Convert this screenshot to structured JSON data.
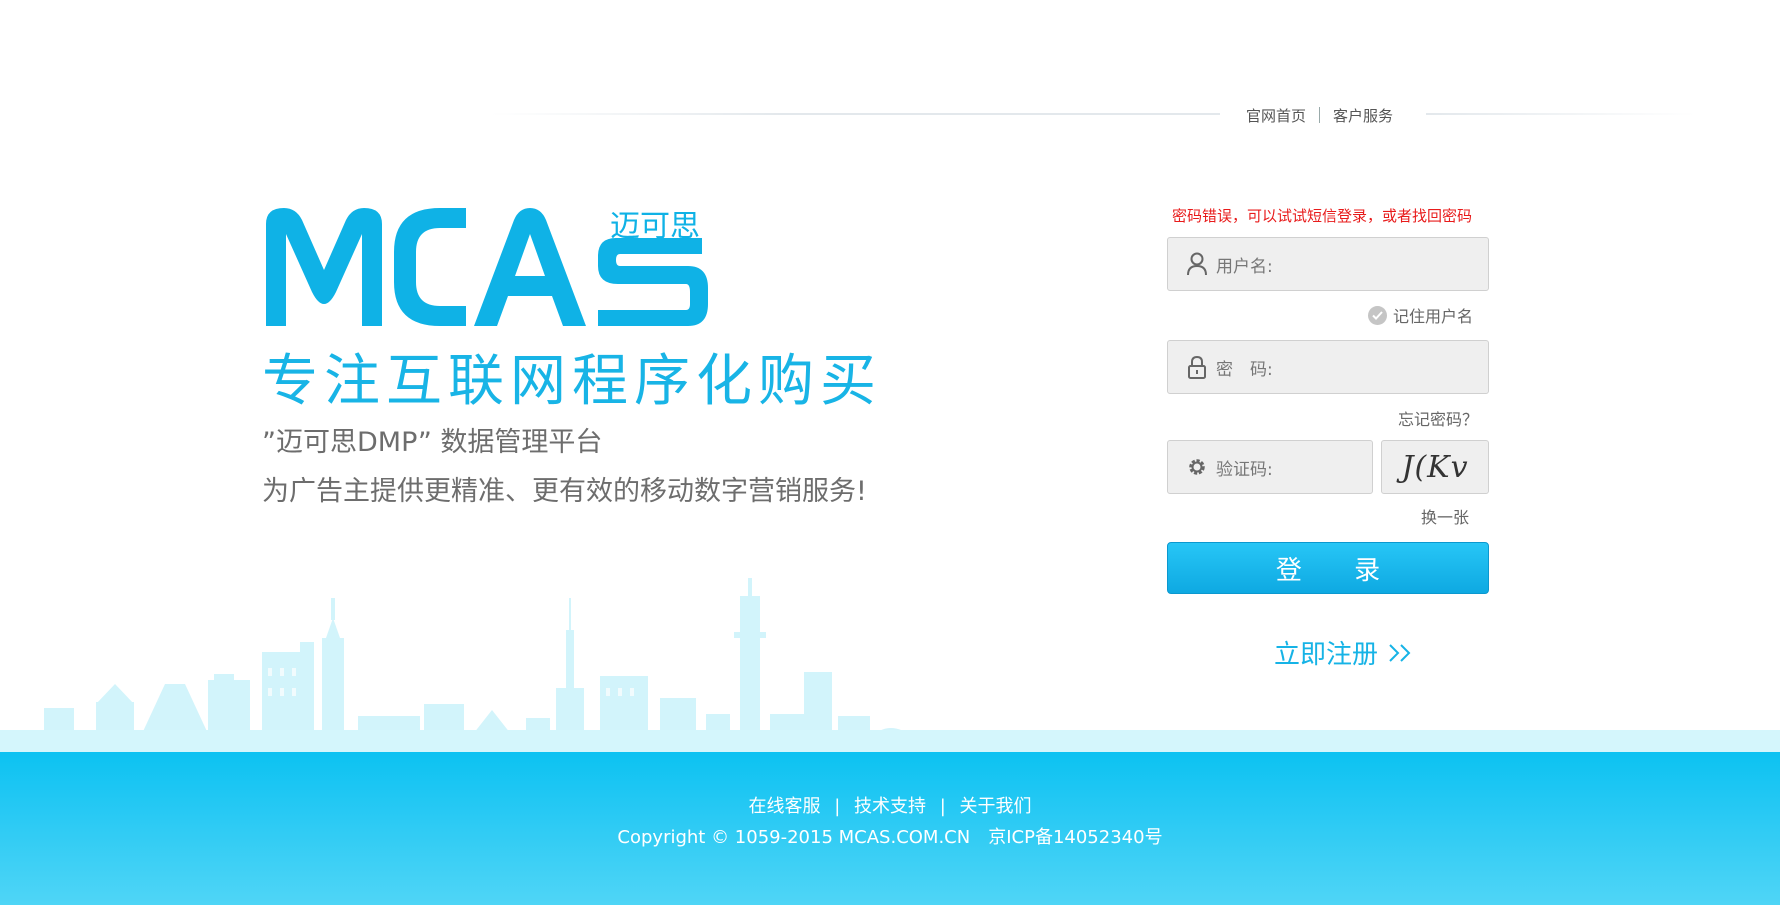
{
  "top_nav": {
    "home": "官网首页",
    "service": "客户服务"
  },
  "brand": {
    "logo_text": "MCAs",
    "logo_cn": "迈可思",
    "slogan": "专注互联网程序化购买",
    "tagline_1": "”迈可思DMP” 数据管理平台",
    "tagline_2": "为广告主提供更精准、更有效的移动数字营销服务!"
  },
  "login": {
    "error_message": "密码错误，可以试试短信登录，或者找回密码",
    "username_label": "用户名:",
    "remember_label": "记住用户名",
    "password_label": "密　码:",
    "forgot_label": "忘记密码？",
    "captcha_label": "验证码:",
    "captcha_text": "J(Kv",
    "refresh_label": "换一张",
    "submit_label": "登 录",
    "register_label": "立即注册"
  },
  "footer": {
    "link_online": "在线客服",
    "link_tech": "技术支持",
    "link_about": "关于我们",
    "separator": "|",
    "copyright": "Copyright © 1059-2015 MCAS.COM.CN　京ICP备14052340号"
  },
  "colors": {
    "brand_blue": "#18b4e6",
    "error_red": "#e81b1b",
    "footer_blue": "#0cc2f2"
  },
  "icons": [
    "user-icon",
    "lock-icon",
    "gear-icon",
    "check-icon",
    "double-chevron-right-icon"
  ]
}
